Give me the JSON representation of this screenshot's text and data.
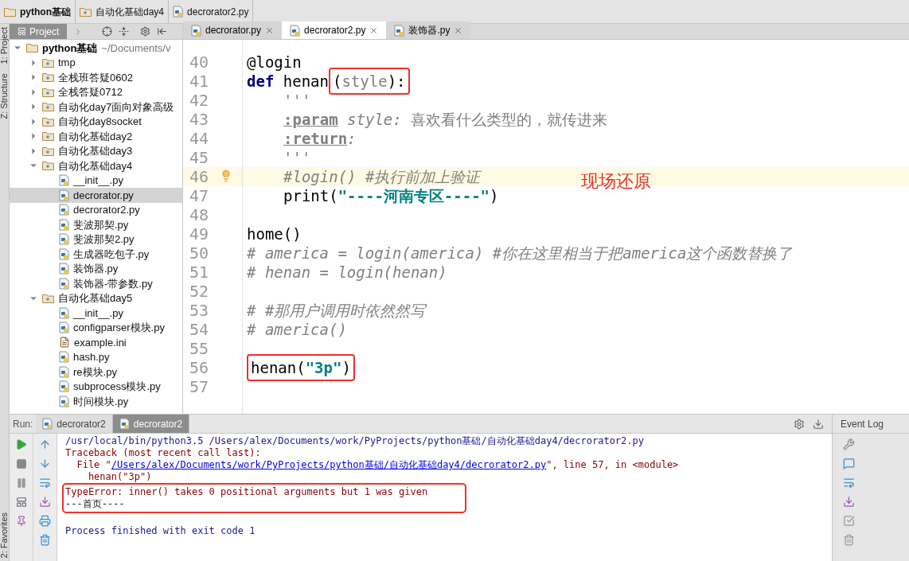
{
  "breadcrumbs": [
    {
      "label": "python基础"
    },
    {
      "label": "自动化基础day4"
    },
    {
      "label": "decrorator2.py"
    }
  ],
  "side_tools": {
    "top": [
      "1: Project",
      "Z: Structure"
    ],
    "bottom": [
      "2: Favorites"
    ]
  },
  "project_panel": {
    "title": "Project",
    "root": {
      "label": "python基础",
      "path": "~/Documents/v",
      "expanded": true,
      "children": [
        {
          "label": "tmp",
          "kind": "folder",
          "expanded": false
        },
        {
          "label": "全栈班答疑0602",
          "kind": "folder",
          "expanded": false
        },
        {
          "label": "全栈答疑0712",
          "kind": "folder",
          "expanded": false
        },
        {
          "label": "自动化day7面向对象高级",
          "kind": "folder",
          "expanded": false
        },
        {
          "label": "自动化day8socket",
          "kind": "folder",
          "expanded": false
        },
        {
          "label": "自动化基础day2",
          "kind": "folder",
          "expanded": false
        },
        {
          "label": "自动化基础day3",
          "kind": "folder",
          "expanded": false
        },
        {
          "label": "自动化基础day4",
          "kind": "folder",
          "expanded": true,
          "children": [
            {
              "label": "__init__.py",
              "kind": "python",
              "selected": false
            },
            {
              "label": "decrorator.py",
              "kind": "python",
              "selected": true
            },
            {
              "label": "decrorator2.py",
              "kind": "python",
              "selected": false
            },
            {
              "label": "斐波那契.py",
              "kind": "python",
              "selected": false
            },
            {
              "label": "斐波那契2.py",
              "kind": "python",
              "selected": false
            },
            {
              "label": "生成器吃包子.py",
              "kind": "python",
              "selected": false
            },
            {
              "label": "装饰器.py",
              "kind": "python",
              "selected": false
            },
            {
              "label": "装饰器-带参数.py",
              "kind": "python",
              "selected": false
            }
          ]
        },
        {
          "label": "自动化基础day5",
          "kind": "folder",
          "expanded": true,
          "children": [
            {
              "label": "__init__.py",
              "kind": "python",
              "selected": false
            },
            {
              "label": "configparser模块.py",
              "kind": "python",
              "selected": false
            },
            {
              "label": "example.ini",
              "kind": "ini",
              "selected": false
            },
            {
              "label": "hash.py",
              "kind": "python",
              "selected": false
            },
            {
              "label": "re模块.py",
              "kind": "python",
              "selected": false
            },
            {
              "label": "subprocess模块.py",
              "kind": "python",
              "selected": false
            },
            {
              "label": "时间模块.py",
              "kind": "python",
              "selected": false
            }
          ]
        }
      ]
    }
  },
  "editor_tabs": [
    {
      "label": "decrorator.py",
      "selected": false
    },
    {
      "label": "decrorator2.py",
      "selected": true
    },
    {
      "label": "装饰器.py",
      "selected": false
    }
  ],
  "code_lines": [
    {
      "number": "40",
      "current": false,
      "indented": false,
      "tokens": [
        {
          "text": "@login",
          "kind": "plain"
        }
      ]
    },
    {
      "number": "41",
      "current": false,
      "indented": false,
      "tokens": [
        {
          "text": "def ",
          "kind": "keyword"
        },
        {
          "text": "henan",
          "kind": "plain"
        },
        {
          "text": "(",
          "kind": "plain",
          "boxed": true
        },
        {
          "text": "style",
          "kind": "doc",
          "boxed": true
        },
        {
          "text": "):",
          "kind": "plain",
          "boxed": true
        }
      ]
    },
    {
      "number": "42",
      "current": false,
      "indented": true,
      "tokens": [
        {
          "text": "'''",
          "kind": "doc"
        }
      ]
    },
    {
      "number": "43",
      "current": false,
      "indented": true,
      "tokens": [
        {
          "text": ":param",
          "kind": "doctag"
        },
        {
          "text": " style:",
          "kind": "docparam"
        },
        {
          "text": " 喜欢看什么类型的，就传进来",
          "kind": "doc"
        }
      ]
    },
    {
      "number": "44",
      "current": false,
      "indented": true,
      "tokens": [
        {
          "text": ":return",
          "kind": "doctag"
        },
        {
          "text": ":",
          "kind": "docparam"
        }
      ]
    },
    {
      "number": "45",
      "current": false,
      "indented": true,
      "tokens": [
        {
          "text": "'''",
          "kind": "doc"
        }
      ]
    },
    {
      "number": "46",
      "current": true,
      "indented": true,
      "tokens": [
        {
          "text": "#login() #执行前加上验证",
          "kind": "comment"
        }
      ]
    },
    {
      "number": "47",
      "current": false,
      "indented": true,
      "tokens": [
        {
          "text": "print(",
          "kind": "plain"
        },
        {
          "text": "\"----河南专区----\"",
          "kind": "string"
        },
        {
          "text": ")",
          "kind": "plain"
        }
      ]
    },
    {
      "number": "48",
      "current": false
    },
    {
      "number": "49",
      "current": false,
      "indented": false,
      "tokens": [
        {
          "text": "home()",
          "kind": "plain"
        }
      ]
    },
    {
      "number": "50",
      "current": false,
      "indented": false,
      "tokens": [
        {
          "text": "# america = login(america) #你在这里相当于把america这个函数替换了",
          "kind": "comment"
        }
      ]
    },
    {
      "number": "51",
      "current": false,
      "indented": false,
      "tokens": [
        {
          "text": "# henan = login(henan)",
          "kind": "comment"
        }
      ]
    },
    {
      "number": "52",
      "current": false
    },
    {
      "number": "53",
      "current": false,
      "indented": false,
      "tokens": [
        {
          "text": "# #那用户调用时依然然写",
          "kind": "comment"
        }
      ]
    },
    {
      "number": "54",
      "current": false,
      "indented": false,
      "tokens": [
        {
          "text": "# america()",
          "kind": "comment"
        }
      ]
    },
    {
      "number": "55",
      "current": false
    },
    {
      "number": "56",
      "current": false,
      "indented": false,
      "tokens": [
        {
          "text": "henan(",
          "kind": "plain",
          "boxed": true
        },
        {
          "text": "\"3p\"",
          "kind": "string",
          "boxed": true
        },
        {
          "text": ")",
          "kind": "plain",
          "boxed": true
        }
      ]
    },
    {
      "number": "57",
      "current": false
    }
  ],
  "annotation": "现场还原",
  "run_panel": {
    "label": "Run:",
    "tabs": [
      {
        "label": "decrorator2",
        "selected": false
      },
      {
        "label": "decrorator2",
        "selected": true
      }
    ],
    "output": [
      {
        "kind": "command",
        "highlighted": false,
        "parts": [
          {
            "t": "/usr/local/bin/python3.5 /Users/alex/Documents/work/PyProjects/python基础/自动化基础day4/decrorator2.py",
            "link": false
          }
        ]
      },
      {
        "kind": "error",
        "highlighted": false,
        "parts": [
          {
            "t": "Traceback (most recent call last):",
            "link": false
          }
        ]
      },
      {
        "kind": "error",
        "highlighted": false,
        "parts": [
          {
            "t": "  File \"",
            "link": false
          },
          {
            "t": "/Users/alex/Documents/work/PyProjects/python基础/自动化基础day4/decrorator2.py",
            "link": true
          },
          {
            "t": "\", line 57, in <module>",
            "link": false
          }
        ]
      },
      {
        "kind": "error",
        "highlighted": false,
        "parts": [
          {
            "t": "    henan(\"3p\")",
            "link": false
          }
        ]
      },
      {
        "kind": "error",
        "highlighted": true,
        "parts": [
          {
            "t": "TypeError: inner() takes 0 positional arguments but 1 was given",
            "link": false
          }
        ]
      },
      {
        "kind": "stdout",
        "highlighted": true,
        "parts": [
          {
            "t": "---首页----",
            "link": false
          }
        ]
      },
      {
        "kind": "blank"
      },
      {
        "kind": "command",
        "highlighted": false,
        "parts": [
          {
            "t": "Process finished with exit code 1",
            "link": false
          }
        ]
      }
    ]
  },
  "event_log": {
    "title": "Event Log"
  }
}
